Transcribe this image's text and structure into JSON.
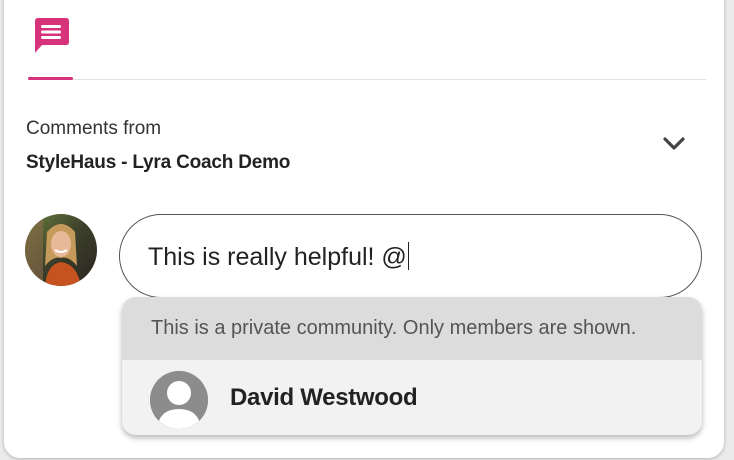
{
  "tabs": [
    {
      "icon": "comment-icon",
      "active": true
    }
  ],
  "header": {
    "comments_from": "Comments from",
    "community_name": "StyleHaus - Lyra Coach Demo"
  },
  "composer": {
    "value": "This is really helpful! @"
  },
  "mention_dropdown": {
    "notice": "This is a private community. Only members are shown.",
    "members": [
      {
        "name": "David Westwood",
        "avatar": "default-avatar-icon"
      }
    ]
  },
  "colors": {
    "accent": "#d6337a",
    "dropdown_header_bg": "#dcdcdc",
    "dropdown_bg": "#f2f2f2"
  }
}
